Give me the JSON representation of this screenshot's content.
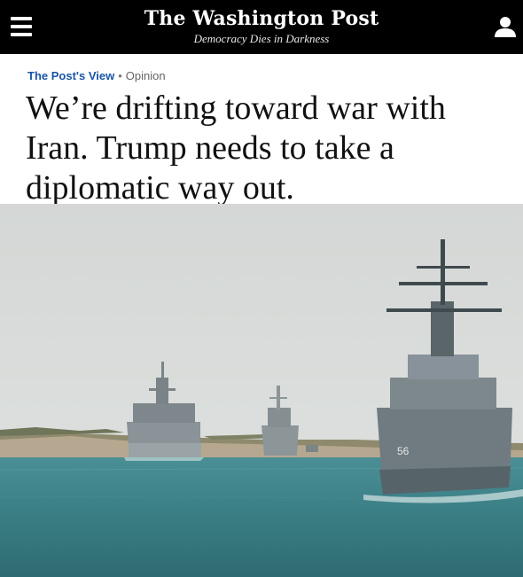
{
  "header": {
    "logo": "The Washington Post",
    "tagline": "Democracy Dies in Darkness",
    "menu_icon": "hamburger-menu-icon",
    "account_icon": "user-account-icon",
    "background": "#000000"
  },
  "article": {
    "section": "The Post's View",
    "separator": "•",
    "label": "Opinion",
    "headline": "We’re drifting toward war with Iran. Trump needs to take a diplomatic way out.",
    "section_color": "#1955a5"
  },
  "hero": {
    "alt": "Navy warships transiting a canal in hazy weather"
  }
}
